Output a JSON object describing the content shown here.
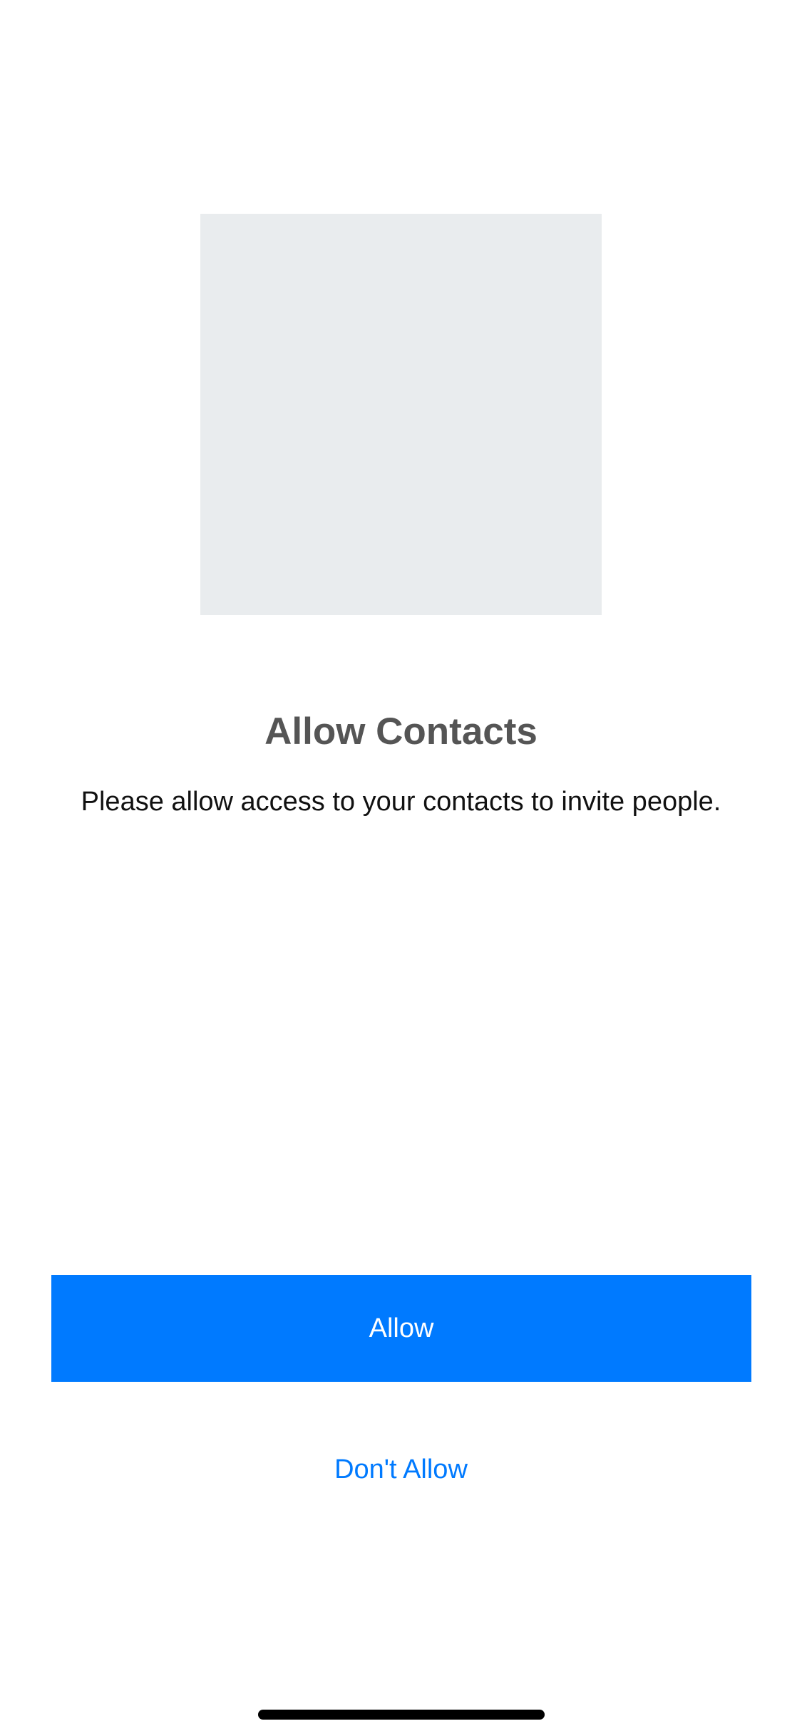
{
  "screen": {
    "title": "Allow Contacts",
    "message": "Please allow access to your contacts to invite people."
  },
  "actions": {
    "allow_label": "Allow",
    "dont_allow_label": "Don't Allow"
  },
  "colors": {
    "accent": "#007aff",
    "placeholder": "#e9ecee",
    "title_text": "#555555",
    "body_text": "#111111",
    "background": "#ffffff"
  },
  "icons": {
    "illustration": "contacts-illustration-placeholder"
  }
}
